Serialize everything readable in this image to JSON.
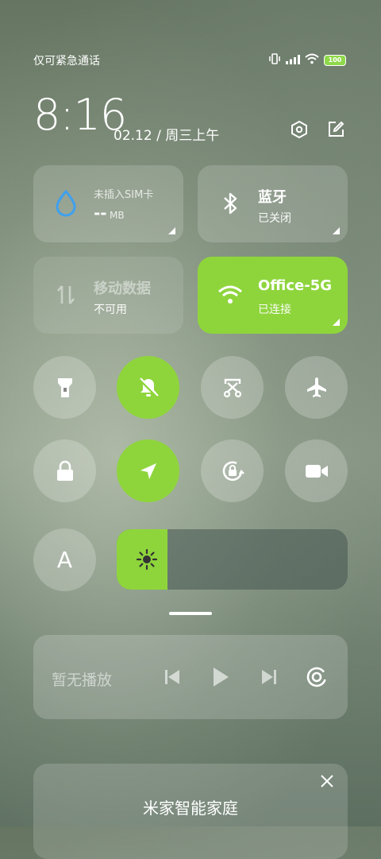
{
  "status_bar": {
    "carrier_text": "仅可紧急通话",
    "battery_level": "100"
  },
  "header": {
    "time": "8:16",
    "date": "02.12 / 周三上午"
  },
  "tiles": {
    "sim": {
      "title": "未插入SIM卡",
      "value": "--",
      "unit": "MB"
    },
    "bluetooth": {
      "title": "蓝牙",
      "status": "已关闭"
    },
    "mobile_data": {
      "title": "移动数据",
      "status": "不可用"
    },
    "wifi": {
      "title": "Office-5G",
      "status": "已连接"
    }
  },
  "toggles": [
    {
      "name": "flashlight",
      "on": false
    },
    {
      "name": "mute",
      "on": true
    },
    {
      "name": "screenshot",
      "on": false
    },
    {
      "name": "airplane-mode",
      "on": false
    },
    {
      "name": "lock-screen",
      "on": false
    },
    {
      "name": "location",
      "on": true
    },
    {
      "name": "auto-rotate-lock",
      "on": false
    },
    {
      "name": "screen-recorder",
      "on": false
    }
  ],
  "auto_brightness_label": "A",
  "brightness_level": 0.22,
  "media": {
    "status": "暂无播放"
  },
  "smart_home": {
    "title": "米家智能家庭"
  },
  "colors": {
    "accent_green": "#8ed53c"
  }
}
